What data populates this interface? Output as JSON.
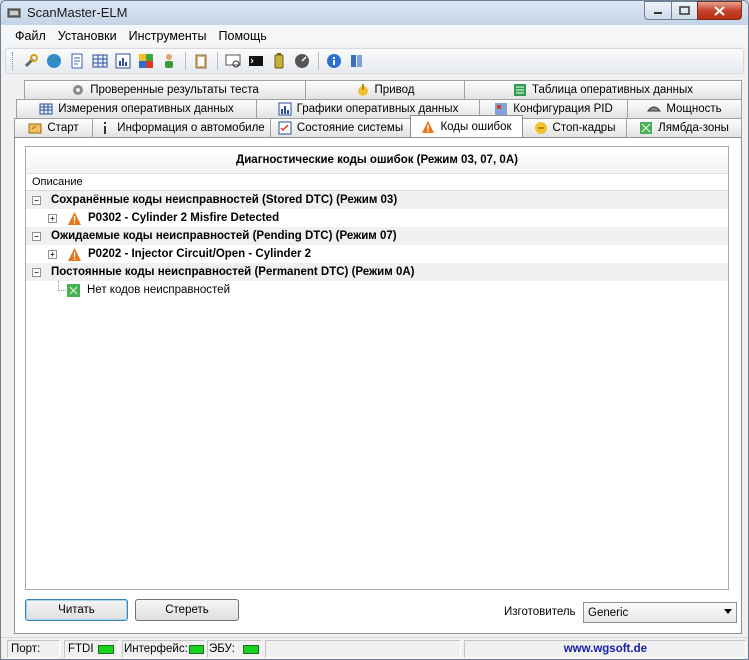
{
  "window": {
    "title": "ScanMaster-ELM"
  },
  "menu": [
    "Файл",
    "Установки",
    "Инструменты",
    "Помощь"
  ],
  "tabs": {
    "row1": [
      "Проверенные результаты теста",
      "Привод",
      "Таблица оперативных данных"
    ],
    "row2": [
      "Измерения оперативных данных",
      "Графики оперативных данных",
      "Конфигурация PID",
      "Мощность"
    ],
    "row3": [
      "Старт",
      "Информация о автомобиле",
      "Состояние системы",
      "Коды ошибок",
      "Стоп-кадры",
      "Лямбда-зоны"
    ],
    "active": "Коды ошибок"
  },
  "dtc": {
    "header": "Диагностические коды ошибок (Режим 03, 07, 0A)",
    "column": "Описание",
    "groups": [
      {
        "label": "Сохранённые коды неисправностей (Stored DTC) (Режим 03)",
        "item": "P0302 - Cylinder 2 Misfire Detected"
      },
      {
        "label": "Ожидаемые коды неисправностей (Pending DTC) (Режим 07)",
        "item": "P0202 - Injector Circuit/Open - Cylinder 2"
      },
      {
        "label": "Постоянные коды неисправностей (Permanent DTC) (Режим 0A)",
        "item": "Нет кодов неисправностей"
      }
    ]
  },
  "buttons": {
    "read": "Читать",
    "clear": "Стереть"
  },
  "manufacturer": {
    "label": "Изготовитель",
    "value": "Generic"
  },
  "status": {
    "port": "Порт:",
    "ftdi": "FTDI",
    "interface": "Интерфейс:",
    "ecu": "ЭБУ:",
    "site": "www.wgsoft.de"
  },
  "colors": {
    "led": "#18d31e",
    "warning": "#e8751a",
    "link": "#1520a6"
  },
  "icons": [
    "wrench-icon",
    "globe-icon",
    "document-icon",
    "table-icon",
    "chart-icon",
    "palette-icon",
    "person-icon",
    "clipboard-icon",
    "terminal-icon",
    "console-icon",
    "battery-icon",
    "gauge-icon",
    "info-icon",
    "book-icon"
  ]
}
